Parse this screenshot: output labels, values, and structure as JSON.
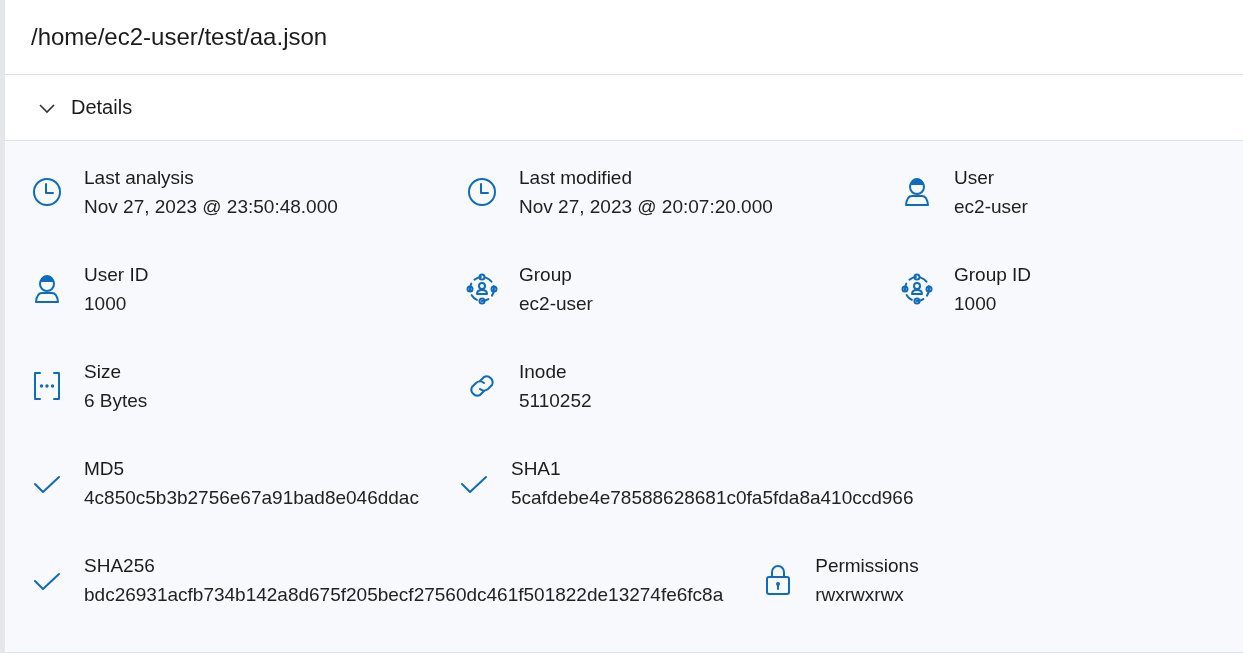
{
  "title": "/home/ec2-user/test/aa.json",
  "details": {
    "label": "Details",
    "expanded": true,
    "rows": [
      [
        {
          "kind": "clock",
          "label": "Last analysis",
          "value": "Nov 27, 2023 @ 23:50:48.000"
        },
        {
          "kind": "clock",
          "label": "Last modified",
          "value": "Nov 27, 2023 @ 20:07:20.000"
        },
        {
          "kind": "user",
          "label": "User",
          "value": "ec2-user"
        }
      ],
      [
        {
          "kind": "user",
          "label": "User ID",
          "value": "1000"
        },
        {
          "kind": "group",
          "label": "Group",
          "value": "ec2-user"
        },
        {
          "kind": "group",
          "label": "Group ID",
          "value": "1000"
        }
      ],
      [
        {
          "kind": "size",
          "label": "Size",
          "value": "6 Bytes"
        },
        {
          "kind": "link",
          "label": "Inode",
          "value": "5110252"
        }
      ],
      [
        {
          "kind": "check",
          "label": "MD5",
          "value": "4c850c5b3b2756e67a91bad8e046ddac"
        },
        {
          "kind": "check",
          "label": "SHA1",
          "value": "5cafdebe4e78588628681c0fa5fda8a410ccd966"
        }
      ],
      [
        {
          "kind": "check",
          "label": "SHA256",
          "value": "bdc26931acfb734b142a8d675f205becf27560dc461f501822de13274fe6fc8a"
        },
        {
          "kind": "lock",
          "label": "Permissions",
          "value": "rwxrwxrwx"
        }
      ]
    ]
  }
}
